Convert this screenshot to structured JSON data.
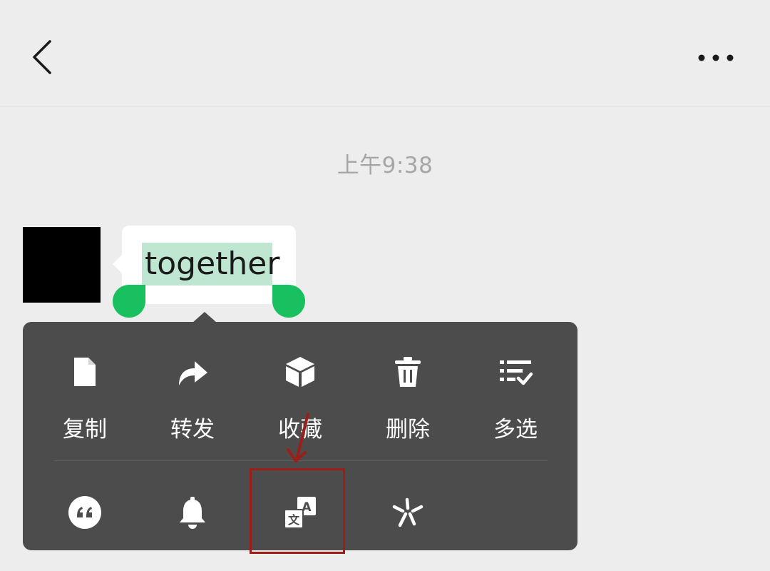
{
  "header": {
    "back_icon": "chevron-left-icon",
    "more_icon": "more-dots-icon"
  },
  "chat": {
    "timestamp": "上午9:38",
    "message": {
      "text": "together",
      "selected": true
    }
  },
  "context_menu": {
    "row1": [
      {
        "label": "复制",
        "icon": "copy-icon"
      },
      {
        "label": "转发",
        "icon": "forward-icon"
      },
      {
        "label": "收藏",
        "icon": "favorite-icon"
      },
      {
        "label": "删除",
        "icon": "delete-icon"
      },
      {
        "label": "多选",
        "icon": "multi-select-icon"
      }
    ],
    "row2": [
      {
        "icon": "quote-icon"
      },
      {
        "icon": "remind-icon"
      },
      {
        "icon": "translate-icon",
        "highlighted": true
      },
      {
        "icon": "search-icon"
      }
    ]
  },
  "colors": {
    "background": "#ededed",
    "bubble": "#ffffff",
    "selection": "#bfe6d1",
    "handle": "#18c05f",
    "menu": "#4c4c4c",
    "annotation": "#9b1f18"
  }
}
